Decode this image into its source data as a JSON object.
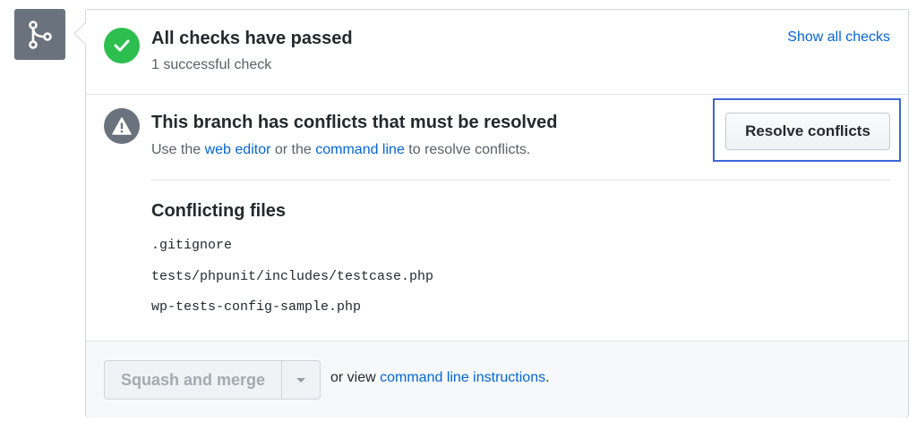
{
  "merge_icon": "git-merge-icon",
  "checks": {
    "status_icon": "check-icon",
    "title": "All checks have passed",
    "subtitle": "1 successful check",
    "show_all_label": "Show all checks"
  },
  "conflicts": {
    "status_icon": "alert-icon",
    "title": "This branch has conflicts that must be resolved",
    "desc_prefix": "Use the ",
    "web_editor_link": "web editor",
    "desc_middle": " or the ",
    "command_line_link": "command line",
    "desc_suffix": " to resolve conflicts.",
    "resolve_button": "Resolve conflicts",
    "files_heading": "Conflicting files",
    "files": [
      ".gitignore",
      "tests/phpunit/includes/testcase.php",
      "wp-tests-config-sample.php"
    ]
  },
  "merge": {
    "button_label": "Squash and merge",
    "dropdown_icon": "caret-down-icon",
    "alt_prefix": "or view ",
    "alt_link": "command line instructions",
    "alt_suffix": "."
  },
  "colors": {
    "success": "#2cbe4e",
    "neutral": "#6a737d",
    "link": "#0366d6",
    "highlight": "#3e64d8"
  }
}
